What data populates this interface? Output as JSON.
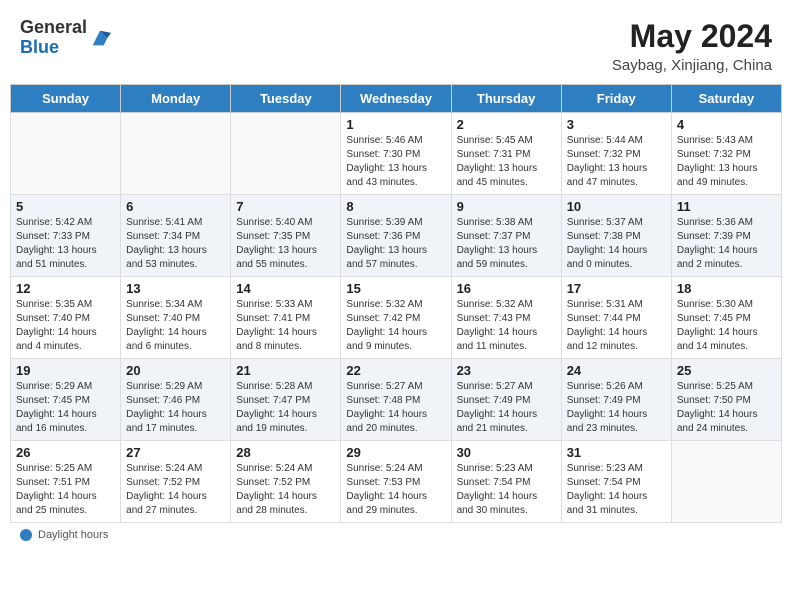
{
  "header": {
    "logo_general": "General",
    "logo_blue": "Blue",
    "month_year": "May 2024",
    "location": "Saybag, Xinjiang, China"
  },
  "days_of_week": [
    "Sunday",
    "Monday",
    "Tuesday",
    "Wednesday",
    "Thursday",
    "Friday",
    "Saturday"
  ],
  "weeks": [
    [
      {
        "day": "",
        "info": ""
      },
      {
        "day": "",
        "info": ""
      },
      {
        "day": "",
        "info": ""
      },
      {
        "day": "1",
        "sunrise": "Sunrise: 5:46 AM",
        "sunset": "Sunset: 7:30 PM",
        "daylight": "Daylight: 13 hours and 43 minutes."
      },
      {
        "day": "2",
        "sunrise": "Sunrise: 5:45 AM",
        "sunset": "Sunset: 7:31 PM",
        "daylight": "Daylight: 13 hours and 45 minutes."
      },
      {
        "day": "3",
        "sunrise": "Sunrise: 5:44 AM",
        "sunset": "Sunset: 7:32 PM",
        "daylight": "Daylight: 13 hours and 47 minutes."
      },
      {
        "day": "4",
        "sunrise": "Sunrise: 5:43 AM",
        "sunset": "Sunset: 7:32 PM",
        "daylight": "Daylight: 13 hours and 49 minutes."
      }
    ],
    [
      {
        "day": "5",
        "sunrise": "Sunrise: 5:42 AM",
        "sunset": "Sunset: 7:33 PM",
        "daylight": "Daylight: 13 hours and 51 minutes."
      },
      {
        "day": "6",
        "sunrise": "Sunrise: 5:41 AM",
        "sunset": "Sunset: 7:34 PM",
        "daylight": "Daylight: 13 hours and 53 minutes."
      },
      {
        "day": "7",
        "sunrise": "Sunrise: 5:40 AM",
        "sunset": "Sunset: 7:35 PM",
        "daylight": "Daylight: 13 hours and 55 minutes."
      },
      {
        "day": "8",
        "sunrise": "Sunrise: 5:39 AM",
        "sunset": "Sunset: 7:36 PM",
        "daylight": "Daylight: 13 hours and 57 minutes."
      },
      {
        "day": "9",
        "sunrise": "Sunrise: 5:38 AM",
        "sunset": "Sunset: 7:37 PM",
        "daylight": "Daylight: 13 hours and 59 minutes."
      },
      {
        "day": "10",
        "sunrise": "Sunrise: 5:37 AM",
        "sunset": "Sunset: 7:38 PM",
        "daylight": "Daylight: 14 hours and 0 minutes."
      },
      {
        "day": "11",
        "sunrise": "Sunrise: 5:36 AM",
        "sunset": "Sunset: 7:39 PM",
        "daylight": "Daylight: 14 hours and 2 minutes."
      }
    ],
    [
      {
        "day": "12",
        "sunrise": "Sunrise: 5:35 AM",
        "sunset": "Sunset: 7:40 PM",
        "daylight": "Daylight: 14 hours and 4 minutes."
      },
      {
        "day": "13",
        "sunrise": "Sunrise: 5:34 AM",
        "sunset": "Sunset: 7:40 PM",
        "daylight": "Daylight: 14 hours and 6 minutes."
      },
      {
        "day": "14",
        "sunrise": "Sunrise: 5:33 AM",
        "sunset": "Sunset: 7:41 PM",
        "daylight": "Daylight: 14 hours and 8 minutes."
      },
      {
        "day": "15",
        "sunrise": "Sunrise: 5:32 AM",
        "sunset": "Sunset: 7:42 PM",
        "daylight": "Daylight: 14 hours and 9 minutes."
      },
      {
        "day": "16",
        "sunrise": "Sunrise: 5:32 AM",
        "sunset": "Sunset: 7:43 PM",
        "daylight": "Daylight: 14 hours and 11 minutes."
      },
      {
        "day": "17",
        "sunrise": "Sunrise: 5:31 AM",
        "sunset": "Sunset: 7:44 PM",
        "daylight": "Daylight: 14 hours and 12 minutes."
      },
      {
        "day": "18",
        "sunrise": "Sunrise: 5:30 AM",
        "sunset": "Sunset: 7:45 PM",
        "daylight": "Daylight: 14 hours and 14 minutes."
      }
    ],
    [
      {
        "day": "19",
        "sunrise": "Sunrise: 5:29 AM",
        "sunset": "Sunset: 7:45 PM",
        "daylight": "Daylight: 14 hours and 16 minutes."
      },
      {
        "day": "20",
        "sunrise": "Sunrise: 5:29 AM",
        "sunset": "Sunset: 7:46 PM",
        "daylight": "Daylight: 14 hours and 17 minutes."
      },
      {
        "day": "21",
        "sunrise": "Sunrise: 5:28 AM",
        "sunset": "Sunset: 7:47 PM",
        "daylight": "Daylight: 14 hours and 19 minutes."
      },
      {
        "day": "22",
        "sunrise": "Sunrise: 5:27 AM",
        "sunset": "Sunset: 7:48 PM",
        "daylight": "Daylight: 14 hours and 20 minutes."
      },
      {
        "day": "23",
        "sunrise": "Sunrise: 5:27 AM",
        "sunset": "Sunset: 7:49 PM",
        "daylight": "Daylight: 14 hours and 21 minutes."
      },
      {
        "day": "24",
        "sunrise": "Sunrise: 5:26 AM",
        "sunset": "Sunset: 7:49 PM",
        "daylight": "Daylight: 14 hours and 23 minutes."
      },
      {
        "day": "25",
        "sunrise": "Sunrise: 5:25 AM",
        "sunset": "Sunset: 7:50 PM",
        "daylight": "Daylight: 14 hours and 24 minutes."
      }
    ],
    [
      {
        "day": "26",
        "sunrise": "Sunrise: 5:25 AM",
        "sunset": "Sunset: 7:51 PM",
        "daylight": "Daylight: 14 hours and 25 minutes."
      },
      {
        "day": "27",
        "sunrise": "Sunrise: 5:24 AM",
        "sunset": "Sunset: 7:52 PM",
        "daylight": "Daylight: 14 hours and 27 minutes."
      },
      {
        "day": "28",
        "sunrise": "Sunrise: 5:24 AM",
        "sunset": "Sunset: 7:52 PM",
        "daylight": "Daylight: 14 hours and 28 minutes."
      },
      {
        "day": "29",
        "sunrise": "Sunrise: 5:24 AM",
        "sunset": "Sunset: 7:53 PM",
        "daylight": "Daylight: 14 hours and 29 minutes."
      },
      {
        "day": "30",
        "sunrise": "Sunrise: 5:23 AM",
        "sunset": "Sunset: 7:54 PM",
        "daylight": "Daylight: 14 hours and 30 minutes."
      },
      {
        "day": "31",
        "sunrise": "Sunrise: 5:23 AM",
        "sunset": "Sunset: 7:54 PM",
        "daylight": "Daylight: 14 hours and 31 minutes."
      },
      {
        "day": "",
        "info": ""
      }
    ]
  ],
  "footer": {
    "daylight_label": "Daylight hours"
  }
}
